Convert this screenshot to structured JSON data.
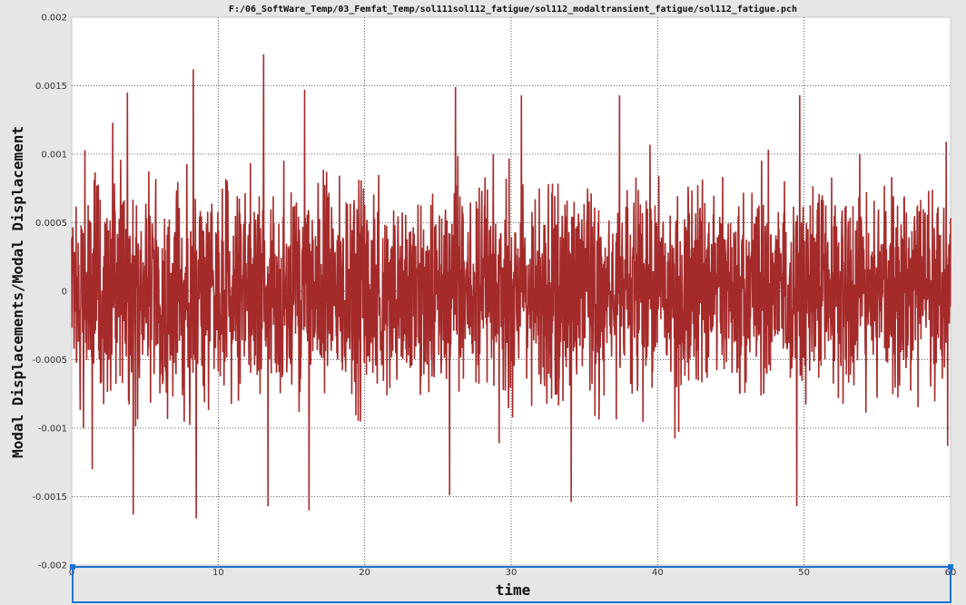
{
  "chart_data": {
    "type": "line",
    "title": "F:/06_SoftWare_Temp/03_Femfat_Temp/sol111sol112_fatigue/sol112_modaltransient_fatigue/sol112_fatigue.pch",
    "xlabel": "time",
    "ylabel": "Modal Displacements/Modal Displacement",
    "xlim": [
      0,
      60
    ],
    "ylim": [
      -0.002,
      0.002
    ],
    "xticks": [
      0,
      10,
      20,
      30,
      40,
      50,
      60
    ],
    "xtick_labels": [
      "0",
      "10",
      "20",
      "30",
      "40",
      "50",
      "60"
    ],
    "yticks": [
      0.002,
      0.0015,
      0.001,
      0.0005,
      0,
      -0.0005,
      -0.001,
      -0.0015,
      -0.002
    ],
    "ytick_labels": [
      "0.002",
      "0.0015",
      "0.001",
      "0.0005",
      "0",
      "-0.0005",
      "-0.001",
      "-0.0015",
      "-0.002"
    ],
    "grid": true,
    "series": [
      {
        "color": "#a52a2a",
        "sampled_peaks": [
          {
            "x": 0.9,
            "y": 0.00103
          },
          {
            "x": 1.4,
            "y": -0.0013
          },
          {
            "x": 2.8,
            "y": 0.00123
          },
          {
            "x": 3.8,
            "y": 0.00145
          },
          {
            "x": 4.2,
            "y": -0.00163
          },
          {
            "x": 8.3,
            "y": 0.00162
          },
          {
            "x": 8.5,
            "y": -0.00166
          },
          {
            "x": 13.1,
            "y": 0.00173
          },
          {
            "x": 13.4,
            "y": -0.00157
          },
          {
            "x": 15.9,
            "y": 0.00147
          },
          {
            "x": 16.2,
            "y": -0.0016
          },
          {
            "x": 25.8,
            "y": -0.00149
          },
          {
            "x": 26.2,
            "y": 0.00149
          },
          {
            "x": 30.7,
            "y": 0.00143
          },
          {
            "x": 34.1,
            "y": -0.00154
          },
          {
            "x": 37.4,
            "y": 0.00143
          },
          {
            "x": 49.5,
            "y": -0.00157
          },
          {
            "x": 49.7,
            "y": 0.00143
          },
          {
            "x": 59.7,
            "y": 0.00109
          },
          {
            "x": 59.8,
            "y": -0.00113
          }
        ],
        "typical_envelope": [
          -0.0009,
          0.0009
        ]
      }
    ]
  }
}
